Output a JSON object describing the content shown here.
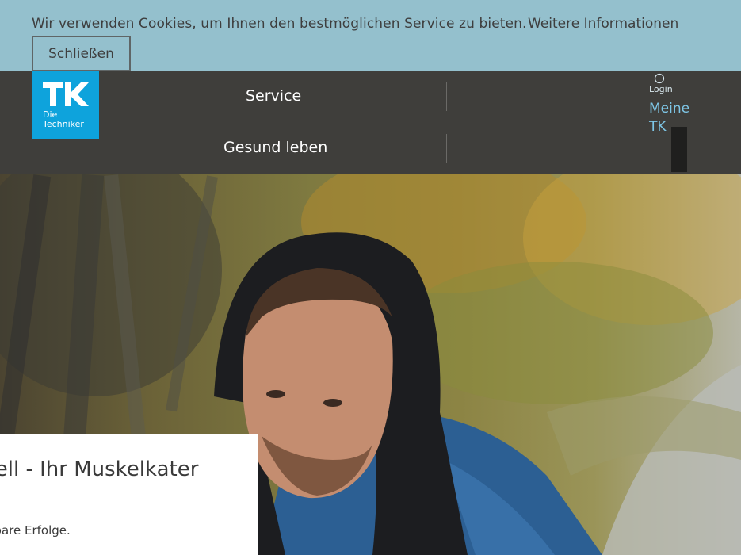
{
  "cookie_banner": {
    "text": "Wir verwenden Cookies, um Ihnen den bestmöglichen Service zu bieten.",
    "link_label": "Weitere Informationen",
    "close_label": "Schließen"
  },
  "header": {
    "logo": {
      "line1": "Die",
      "line2": "Techniker",
      "brand_color": "#0ea3dc"
    },
    "nav": [
      {
        "label": "Service"
      },
      {
        "label": "Gesund leben"
      }
    ],
    "login": {
      "icon": "user-icon",
      "label": "Login",
      "meine_line1": "Meine",
      "meine_line2": "TK"
    }
  },
  "hero": {
    "image": "hooded-runner-photo",
    "teaser": {
      "title": "Schnell - Ihr Muskelkater",
      "text": "für Sie spürbare Erfolge."
    }
  },
  "colors": {
    "cookie_bg": "#94c0cd",
    "header_bg": "#3f3e3b",
    "login_accent": "#7ec6e6"
  }
}
